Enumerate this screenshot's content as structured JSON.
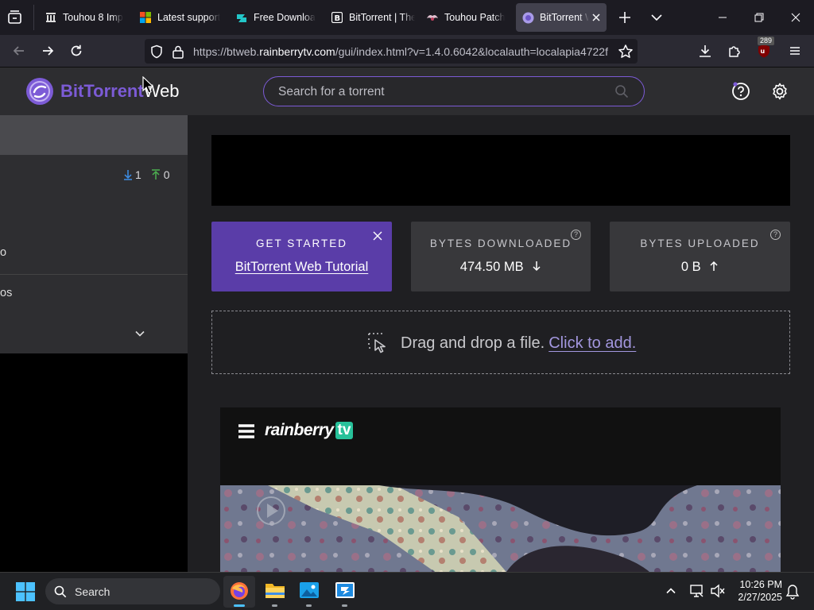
{
  "browser": {
    "tabs": [
      {
        "title": "Touhou 8 Imp",
        "icon": "columns-icon"
      },
      {
        "title": "Latest support",
        "icon": "windows-logo-icon"
      },
      {
        "title": "Free Downloa",
        "icon": "dl-icon"
      },
      {
        "title": "BitTorrent | The",
        "icon": "bittorrent-b-icon"
      },
      {
        "title": "Touhou Patch",
        "icon": "touhou-icon"
      },
      {
        "title": "BitTorrent W",
        "icon": "bittorrent-web-icon",
        "active": true
      }
    ],
    "url_prefix": "https://btweb.",
    "url_domain": "rainberrytv.com",
    "url_suffix": "/gui/index.html?v=1.4.0.6042&localauth=localapia4722f",
    "extension_badge": "289"
  },
  "app": {
    "logo_main": "BitTorrent",
    "logo_sub": "Web",
    "search_placeholder": "Search for a torrent",
    "brand_color": "#7c5bd6"
  },
  "sidebar": {
    "down_count": "1",
    "up_count": "0",
    "item_1_tail": "o",
    "item_2_tail": "os"
  },
  "cards": {
    "get_started_label": "GET STARTED",
    "tutorial_link": "BitTorrent Web Tutorial",
    "downloaded_label": "BYTES DOWNLOADED",
    "downloaded_value": "474.50 MB",
    "uploaded_label": "BYTES UPLOADED",
    "uploaded_value": "0 B"
  },
  "dropzone": {
    "text": "Drag and drop a file.",
    "link": "Click to add."
  },
  "ad": {
    "brand_word": "rainberry",
    "brand_badge": "tv"
  },
  "taskbar": {
    "search_label": "Search",
    "time": "10:26 PM",
    "date": "2/27/2025"
  }
}
